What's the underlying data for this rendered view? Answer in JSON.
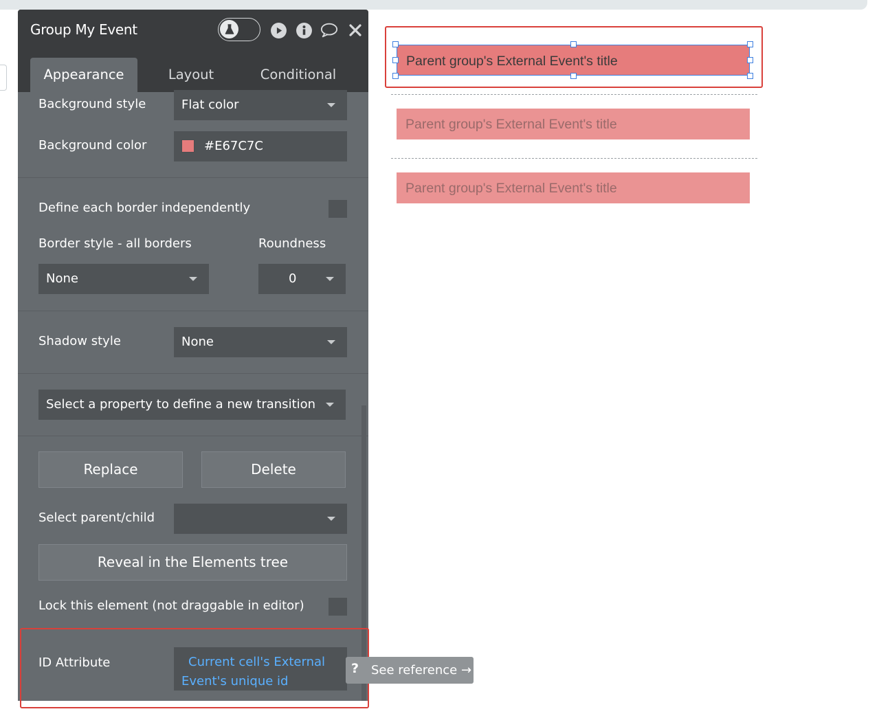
{
  "panel": {
    "title": "Group My Event",
    "tabs": [
      {
        "label": "Appearance",
        "active": true
      },
      {
        "label": "Layout",
        "active": false
      },
      {
        "label": "Conditional",
        "active": false
      }
    ]
  },
  "appearance": {
    "background_style_label": "Background style",
    "background_style_value": "Flat color",
    "background_color_label": "Background color",
    "background_color_value": "#E67C7C",
    "define_borders_label": "Define each border independently",
    "border_style_label": "Border style - all borders",
    "border_style_value": "None",
    "roundness_label": "Roundness",
    "roundness_value": "0",
    "shadow_style_label": "Shadow style",
    "shadow_style_value": "None",
    "transition_placeholder": "Select a property to define a new transition",
    "replace_label": "Replace",
    "delete_label": "Delete",
    "parent_child_label": "Select parent/child",
    "parent_child_value": "",
    "reveal_label": "Reveal in the Elements tree",
    "lock_label": "Lock this element (not draggable in editor)",
    "id_attribute_label": "ID Attribute",
    "id_attribute_value_line1": "Current cell's External",
    "id_attribute_value_line2": "Event's unique id",
    "see_reference_label": "See reference →"
  },
  "canvas": {
    "cells": [
      {
        "text": "Parent group's External Event's title",
        "selected": true
      },
      {
        "text": "Parent group's External Event's title",
        "selected": false
      },
      {
        "text": "Parent group's External Event's title",
        "selected": false
      }
    ]
  },
  "colors": {
    "cell_background": "#E67C7C",
    "cell_background_faded": "#EA9393",
    "cell_text": "#3a3a3a",
    "cell_text_faded": "#9a6a6a",
    "highlight_red": "#D9403A",
    "link_blue": "#5AB0FF",
    "panel_bg": "#666B6F",
    "header_bg": "#3A3C3E"
  },
  "icons": {
    "test_mode": "flask-icon",
    "preview": "play-icon",
    "info": "info-icon",
    "comment": "comment-icon",
    "close": "close-icon"
  }
}
